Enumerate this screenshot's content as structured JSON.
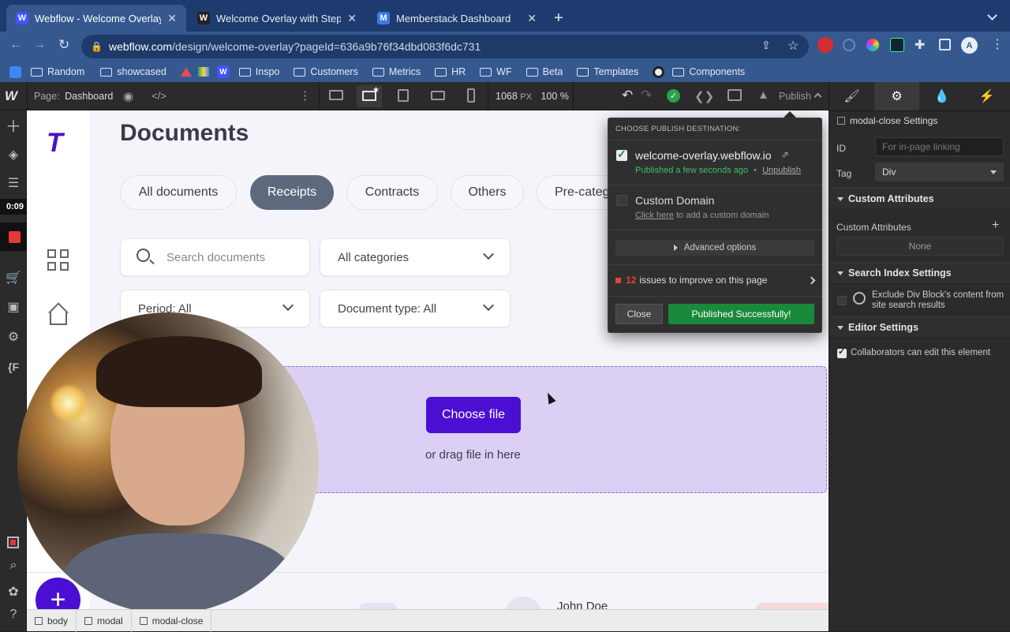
{
  "browser": {
    "tabs": [
      {
        "title": "Webflow - Welcome Overlay w",
        "favicon": "W",
        "color": "#4353ff",
        "active": true
      },
      {
        "title": "Welcome Overlay with Steps",
        "favicon": "W",
        "color": "#222222",
        "active": false
      },
      {
        "title": "Memberstack Dashboard",
        "favicon": "M",
        "color": "#3b7be6",
        "active": false
      }
    ],
    "new_tab": "+",
    "url_host": "webflow.com",
    "url_path": "/design/welcome-overlay?pageId=636a9b76f34dbd083f6dc731",
    "bookmarks": [
      "Random",
      "showcased",
      "Inspo",
      "Customers",
      "Metrics",
      "HR",
      "WF",
      "Beta",
      "Templates",
      "Components"
    ]
  },
  "designer": {
    "page_label": "Page:",
    "page_name": "Dashboard",
    "width_value": "1068",
    "width_unit": "PX",
    "zoom": "100 %",
    "publish_label": "Publish",
    "timer": "0:09"
  },
  "canvas": {
    "logo": "T",
    "heading": "Documents",
    "filters": [
      "All documents",
      "Receipts",
      "Contracts",
      "Others",
      "Pre-categ"
    ],
    "search_placeholder": "Search documents",
    "categories": "All categories",
    "period": "Period: All",
    "doc_type": "Document type: All",
    "choose_file": "Choose file",
    "drag_hint": "or drag file in here",
    "user_name": "John Doe",
    "fab": "+"
  },
  "publish_popover": {
    "header": "CHOOSE PUBLISH DESTINATION:",
    "domain": "welcome-overlay.webflow.io",
    "status": "Published a few seconds ago",
    "unpublish": "Unpublish",
    "custom_domain": "Custom Domain",
    "custom_hint_link": "Click here",
    "custom_hint_rest": "to add a custom domain",
    "advanced": "Advanced options",
    "issues_count": "12",
    "issues_text": "issues to improve on this page",
    "close": "Close",
    "published_btn": "Published Successfully!"
  },
  "right_panel": {
    "element_settings": "modal-close Settings",
    "id_label": "ID",
    "id_placeholder": "For in-page linking",
    "tag_label": "Tag",
    "tag_value": "Div",
    "custom_attributes": "Custom Attributes",
    "custom_attributes_label": "Custom Attributes",
    "custom_attributes_value": "None",
    "search_index": "Search Index Settings",
    "exclude_text": "Exclude Div Block's content from site search results",
    "editor_settings": "Editor Settings",
    "collaborators": "Collaborators can edit this element"
  },
  "breadcrumb": [
    "body",
    "modal",
    "modal-close"
  ],
  "colors": {
    "accent_purple": "#4a0fd3",
    "publish_green": "#1a8a3a",
    "published_text": "#3fbf6a",
    "issue_red": "#e0453a"
  }
}
